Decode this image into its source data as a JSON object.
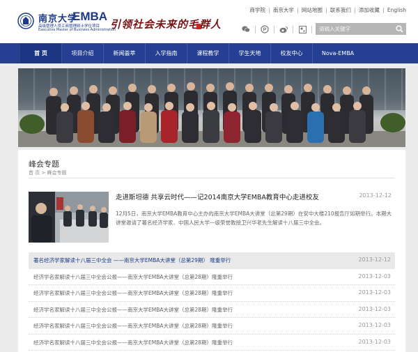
{
  "header": {
    "logo_cn": "南京大学",
    "logo_en": "EMBA",
    "logo_sub_cn": "高级管理人员工商管理硕士学位项目",
    "logo_sub_en": "Executive Master of Business Administration",
    "slogan": "引领社会未来的毛群人",
    "top_links": [
      "商学院",
      "南京大学",
      "网站地图",
      "联系我们",
      "添加收藏",
      "English"
    ],
    "social_icons": [
      "wechat-icon",
      "p-icon",
      "weibo-icon",
      "qrcode-icon",
      "book-icon"
    ],
    "search_placeholder": "请输入关键字"
  },
  "nav": {
    "items": [
      "首 页",
      "项目介绍",
      "新闻荟萃",
      "入学指南",
      "课程教学",
      "学生天地",
      "校友中心",
      "Nova-EMBA"
    ],
    "active_index": 0
  },
  "section": {
    "title": "峰会专题",
    "breadcrumb": "首 页 > 峰会专题"
  },
  "feature": {
    "title": "走进斯坦德 共享云时代——记2014南京大学EMBA教育中心走进校友",
    "date": "2013-12-12",
    "desc": "12月5日，南京大学EMBA教育中心主办的南京大学EMBA大讲堂（总第29期）在安中大楼210报告厅如期举行。本期大讲堂邀请了著名经济学家、中国人民大学一级荣誉教授卫兴华老先生解读十八届三中全会。"
  },
  "list": [
    {
      "title": "著名经济学家解读十八届三中全会 ——南京大学EMBA大讲堂（总第29期） 隆重举行",
      "date": "2013-12-12",
      "highlight": true
    },
    {
      "title": "经济学名家解读十八届三中全会公报——南京大学EMBA大讲堂（总第28期）隆重举行",
      "date": "2013-12-03",
      "highlight": false
    },
    {
      "title": "经济学名家解读十八届三中全会公报——南京大学EMBA大讲堂（总第28期）隆重举行",
      "date": "2013-12-03",
      "highlight": false
    },
    {
      "title": "经济学名家解读十八届三中全会公报——南京大学EMBA大讲堂（总第28期）隆重举行",
      "date": "2013-12-03",
      "highlight": false
    },
    {
      "title": "经济学名家解读十八届三中全会公报——南京大学EMBA大讲堂（总第28期）隆重举行",
      "date": "2013-12-03",
      "highlight": false
    },
    {
      "title": "经济学名家解读十八届三中全会公报——南京大学EMBA大讲堂（总第28期）隆重举行",
      "date": "2013-12-03",
      "highlight": false
    }
  ],
  "colors": {
    "nav_bg": "#243f93",
    "brand_blue": "#1d3a8a",
    "slogan_red": "#7a1414",
    "panel_bg": "#ffffff",
    "page_bg": "#ececec"
  }
}
